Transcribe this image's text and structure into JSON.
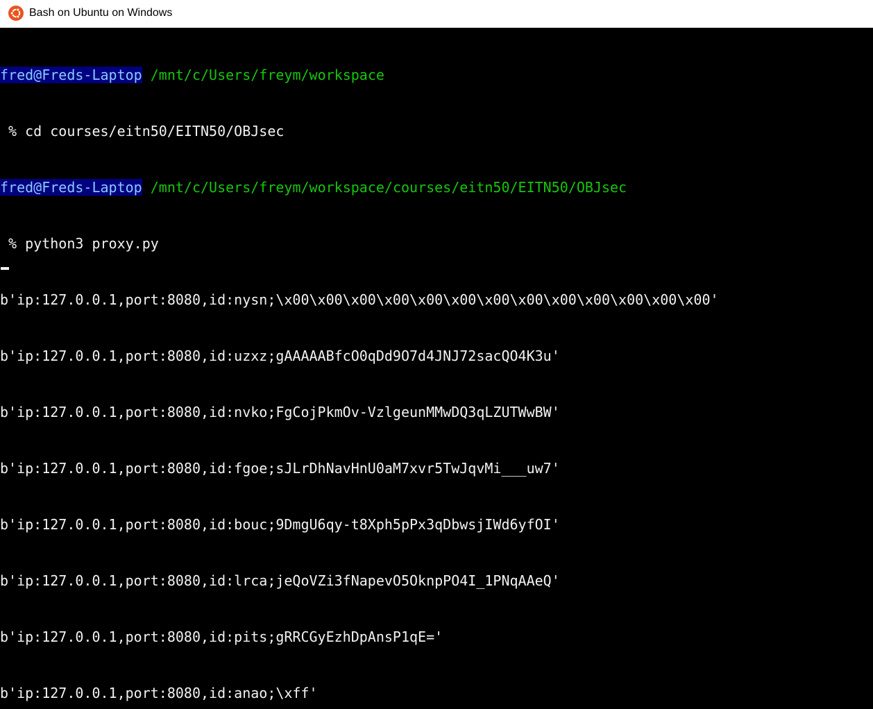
{
  "window": {
    "title": "Bash on Ubuntu on Windows",
    "icon": "ubuntu-logo-icon",
    "accent": "#e95420"
  },
  "colors": {
    "background": "#000000",
    "prompt_user_bg": "#000080",
    "prompt_user_fg": "#8cc8ff",
    "prompt_path": "#16c60c",
    "text": "#f2f2f2"
  },
  "terminal": {
    "prompt1": {
      "user": "fred@Freds-Laptop",
      "path": "/mnt/c/Users/freym/workspace",
      "command": " % cd courses/eitn50/EITN50/OBJsec"
    },
    "prompt2": {
      "user": "fred@Freds-Laptop",
      "path": "/mnt/c/Users/freym/workspace/courses/eitn50/EITN50/OBJsec",
      "command": " % python3 proxy.py"
    },
    "output": [
      "b'ip:127.0.0.1,port:8080,id:nysn;\\x00\\x00\\x00\\x00\\x00\\x00\\x00\\x00\\x00\\x00\\x00\\x00\\x00'",
      "b'ip:127.0.0.1,port:8080,id:uzxz;gAAAAABfcO0qDd9O7d4JNJ72sacQO4K3u'",
      "b'ip:127.0.0.1,port:8080,id:nvko;FgCojPkmOv-VzlgeunMMwDQ3qLZUTWwBW'",
      "b'ip:127.0.0.1,port:8080,id:fgoe;sJLrDhNavHnU0aM7xvr5TwJqvMi___uw7'",
      "b'ip:127.0.0.1,port:8080,id:bouc;9DmgU6qy-t8Xph5pPx3qDbwsjIWd6yfOI'",
      "b'ip:127.0.0.1,port:8080,id:lrca;jeQoVZi3fNapevO5OknpPO4I_1PNqAAeQ'",
      "b'ip:127.0.0.1,port:8080,id:pits;gRRCGyEzhDpAnsP1qE='",
      "b'ip:127.0.0.1,port:8080,id:anao;\\xff'"
    ]
  }
}
